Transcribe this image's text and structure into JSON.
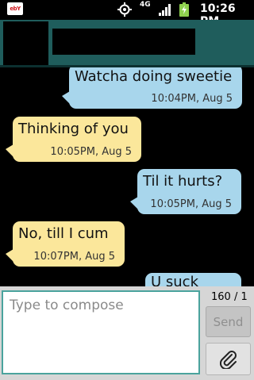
{
  "status_bar": {
    "app_icon": "ebay-icon",
    "app_icon_text": "ebY",
    "gps_icon": "gps-crosshair-icon",
    "network_type": "4G",
    "signal_icon": "signal-bars-icon",
    "battery_icon": "battery-charging-icon",
    "time": "10:26 PM"
  },
  "header": {
    "avatar": "contact-avatar-redacted",
    "contact_name": "",
    "colors": {
      "background": "#1f5d5c"
    }
  },
  "messages": [
    {
      "direction": "outgoing",
      "text": "Watcha doing sweetie",
      "time": "10:04PM, Aug 5"
    },
    {
      "direction": "incoming",
      "text": "Thinking of you",
      "time": "10:05PM, Aug 5"
    },
    {
      "direction": "outgoing",
      "text": "Til it hurts?",
      "time": "10:05PM, Aug 5"
    },
    {
      "direction": "incoming",
      "text": "No, till I cum",
      "time": "10:07PM, Aug 5"
    },
    {
      "direction": "outgoing",
      "text": "U suck",
      "time": ""
    }
  ],
  "compose": {
    "placeholder": "Type to compose",
    "value": "",
    "char_counter": "160 / 1",
    "send_label": "Send",
    "attach_icon": "paperclip-icon"
  },
  "colors": {
    "outgoing_bubble": "#a8d6ec",
    "incoming_bubble": "#fbe79b",
    "compose_border": "#4aa39d"
  }
}
